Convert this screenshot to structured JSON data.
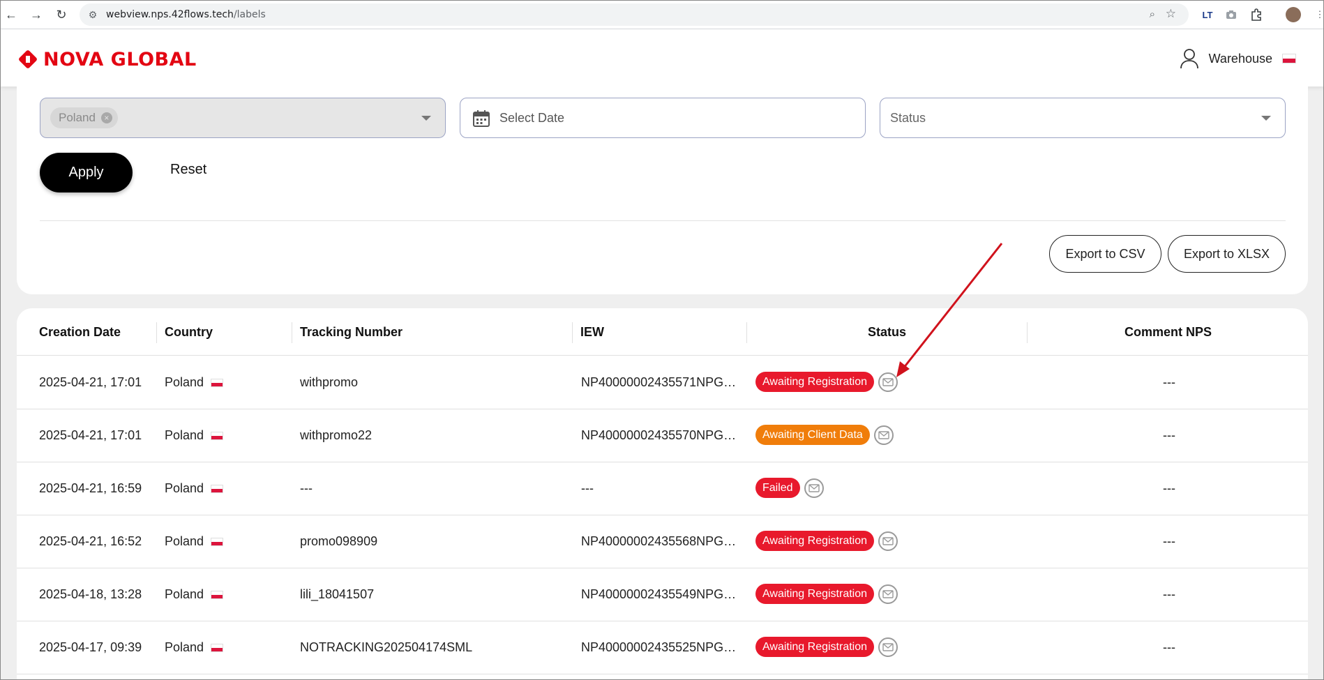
{
  "browser": {
    "url_host": "webview.nps.42flows.tech",
    "url_path": "/labels"
  },
  "header": {
    "logo_text": "NOVA GLOBAL",
    "user_label": "Warehouse"
  },
  "filters": {
    "country_chip": "Poland",
    "date_placeholder": "Select Date",
    "status_placeholder": "Status",
    "apply_label": "Apply",
    "reset_label": "Reset",
    "export_csv_label": "Export to CSV",
    "export_xlsx_label": "Export to XLSX"
  },
  "table": {
    "columns": [
      "Creation Date",
      "Country",
      "Tracking Number",
      "IEW",
      "Status",
      "Comment NPS"
    ],
    "rows": [
      {
        "date": "2025-04-21, 17:01",
        "country": "Poland",
        "tracking": "withpromo",
        "iew": "NP40000002435571NPG…",
        "status": "Awaiting Registration",
        "status_color": "#e8192c",
        "comment": "---"
      },
      {
        "date": "2025-04-21, 17:01",
        "country": "Poland",
        "tracking": "withpromo22",
        "iew": "NP40000002435570NPG…",
        "status": "Awaiting Client Data",
        "status_color": "#f07d0a",
        "comment": "---"
      },
      {
        "date": "2025-04-21, 16:59",
        "country": "Poland",
        "tracking": "---",
        "iew": "---",
        "status": "Failed",
        "status_color": "#e8192c",
        "comment": "---"
      },
      {
        "date": "2025-04-21, 16:52",
        "country": "Poland",
        "tracking": "promo098909",
        "iew": "NP40000002435568NPG…",
        "status": "Awaiting Registration",
        "status_color": "#e8192c",
        "comment": "---"
      },
      {
        "date": "2025-04-18, 13:28",
        "country": "Poland",
        "tracking": "lili_18041507",
        "iew": "NP40000002435549NPG…",
        "status": "Awaiting Registration",
        "status_color": "#e8192c",
        "comment": "---"
      },
      {
        "date": "2025-04-17, 09:39",
        "country": "Poland",
        "tracking": "NOTRACKING202504174SML",
        "iew": "NP40000002435525NPG…",
        "status": "Awaiting Registration",
        "status_color": "#e8192c",
        "comment": "---"
      }
    ]
  },
  "colors": {
    "brand": "#e30613",
    "awaiting_registration": "#e8192c",
    "awaiting_client_data": "#f07d0a",
    "annotation_arrow": "#d0121c"
  },
  "icons": [
    "back-icon",
    "forward-icon",
    "reload-icon",
    "site-settings-icon",
    "zoom-icon",
    "star-icon",
    "user-icon",
    "flag-poland-icon",
    "calendar-icon",
    "mail-icon"
  ]
}
